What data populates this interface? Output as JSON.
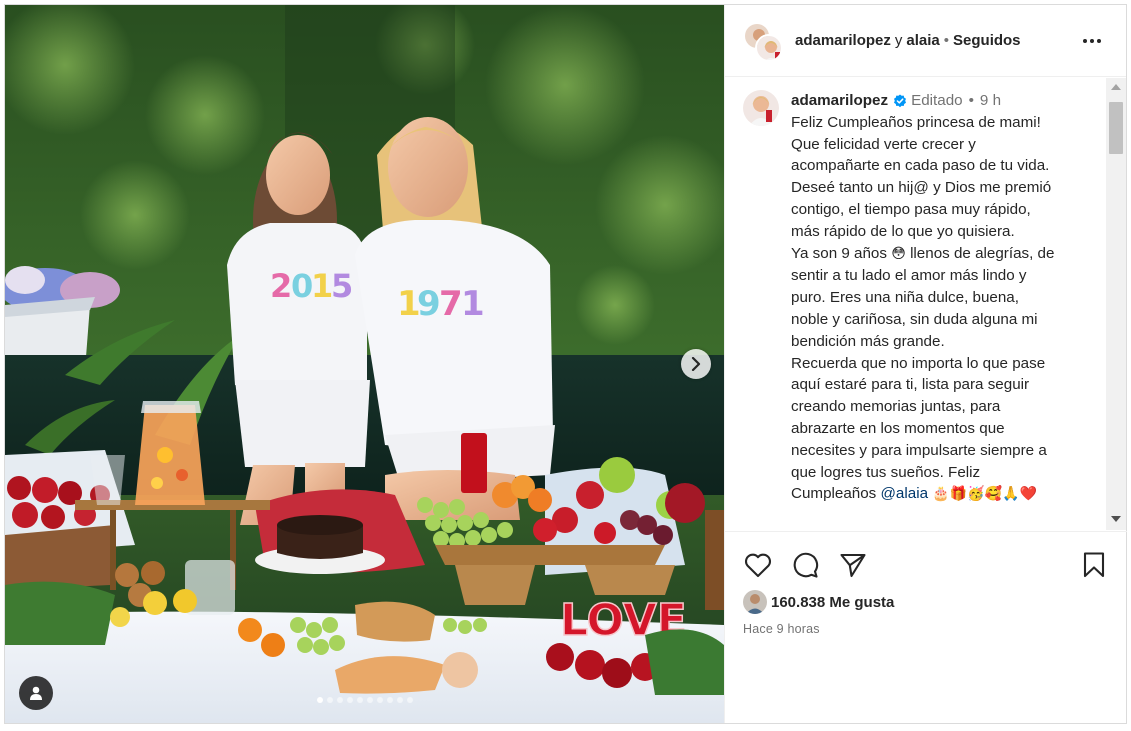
{
  "media": {
    "carousel": {
      "slide_count": 10,
      "active_index": 0
    },
    "shirt_left_text": "2015",
    "shirt_right_text": "1971",
    "love_sign_text": "LOVE"
  },
  "header": {
    "username": "adamarilopez",
    "conjunction": "y",
    "collaborator": "alaia",
    "separator": "•",
    "follow_status": "Seguidos"
  },
  "caption": {
    "username": "adamarilopez",
    "edited_label": "Editado",
    "separator": "•",
    "time_ago": "9 h",
    "lines": [
      "Feliz Cumpleaños princesa de mami!",
      "Que felicidad verte crecer y",
      "acompañarte en cada paso de tu vida.",
      "Deseé tanto un hij@ y Dios me premió",
      "contigo, el tiempo pasa muy rápido,",
      "más rápido de lo que yo quisiera."
    ],
    "line_nine_before": "Ya son 9 años",
    "line_nine_emoji": "😳",
    "line_nine_after": "llenos de alegrías, de",
    "lines_2": [
      "sentir a tu lado el amor más lindo y",
      "puro. Eres una niña dulce, buena,",
      "noble y cariñosa, sin duda alguna mi",
      "bendición más grande.",
      "Recuerda que no importa lo que pase",
      "aquí estaré para ti, lista para seguir",
      "creando memorias juntas, para",
      "abrazarte en los momentos que",
      "necesites y para impulsarte siempre a",
      "que logres tus sueños. Feliz"
    ],
    "last_line_start": "Cumpleaños",
    "mention": "@alaia",
    "emojis": [
      "🎂",
      "🎁",
      "🥳",
      "🥰",
      "🙏",
      "❤️"
    ]
  },
  "stats": {
    "likes": "160.838 Me gusta",
    "timestamp": "Hace 9 horas"
  },
  "colors": {
    "text_primary": "#262626",
    "text_secondary": "#737373",
    "mention": "#00376b",
    "verified": "#0095f6",
    "border": "#efefef"
  },
  "icons": [
    "verified-badge-icon",
    "more-options-icon",
    "heart-icon",
    "comment-icon",
    "share-icon",
    "bookmark-icon",
    "next-arrow-icon",
    "user-tag-icon"
  ]
}
